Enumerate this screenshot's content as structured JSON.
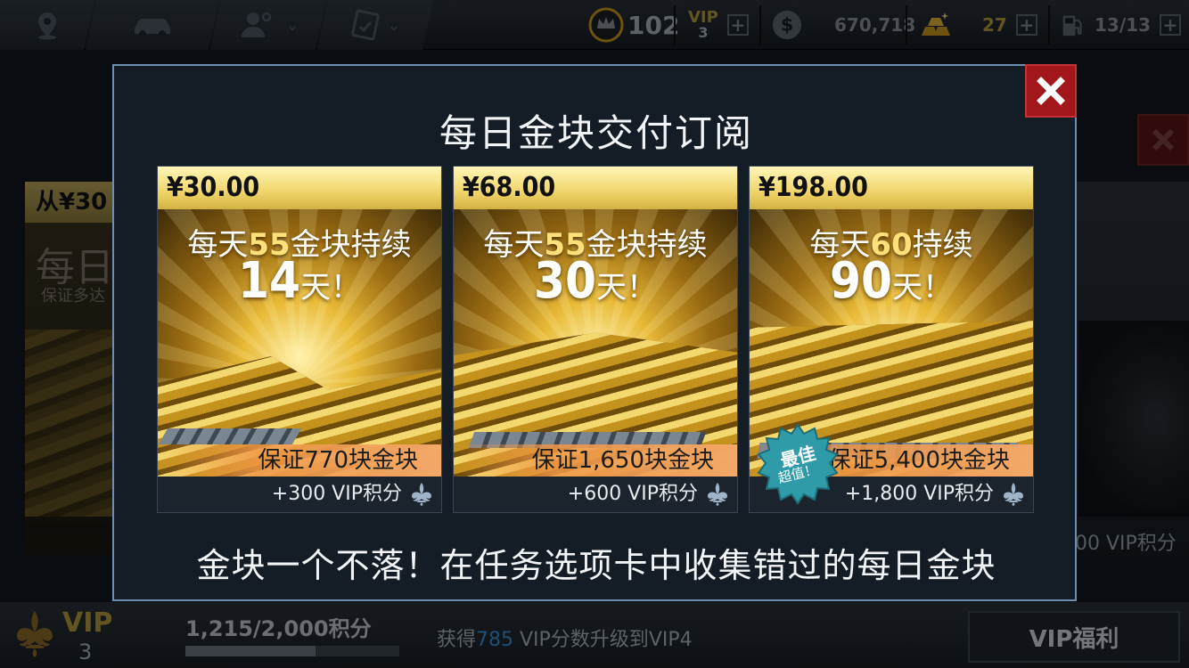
{
  "topbar": {
    "crown_value": "102",
    "vip_label": "VIP",
    "vip_level": "3",
    "cash_value": "670,718",
    "gold_value": "27",
    "fuel_value": "13/13"
  },
  "background": {
    "left_price": "从¥30",
    "left_title": "每日",
    "left_subtitle": "保证多达",
    "right_vip_points": "00 VIP积分"
  },
  "modal": {
    "title": "每日金块交付订阅",
    "footer": "金块一个不落！在任务选项卡中收集错过的每日金块",
    "cards": [
      {
        "price": "¥30.00",
        "line1_pre": "每天",
        "line1_num": "55",
        "line1_post": "金块持续",
        "days": "14",
        "days_suffix": "天！",
        "guarantee": "保证770块金块",
        "vip_points": "+300 VIP积分"
      },
      {
        "price": "¥68.00",
        "line1_pre": "每天",
        "line1_num": "55",
        "line1_post": "金块持续",
        "days": "30",
        "days_suffix": "天！",
        "guarantee": "保证1,650块金块",
        "vip_points": "+600 VIP积分"
      },
      {
        "price": "¥198.00",
        "line1_pre": "每天",
        "line1_num": "60",
        "line1_post": "持续",
        "days": "90",
        "days_suffix": "天！",
        "guarantee": "保证5,400块金块",
        "vip_points": "+1,800 VIP积分",
        "badge_line1": "最佳",
        "badge_line2": "超值！"
      }
    ]
  },
  "bottombar": {
    "vip_label": "VIP",
    "vip_level": "3",
    "progress_text": "1,215/2,000积分",
    "progress_fraction": 0.6075,
    "upgrade_pre": "获得",
    "upgrade_points": "785",
    "upgrade_post": " VIP分数升级到VIP4",
    "benefit_button": "VIP福利"
  },
  "colors": {
    "modal_border": "#6f8fb2",
    "close_red": "#a2171b",
    "price_gold": "#f0d46a",
    "vip_gold": "#b59b3c",
    "highlight_blue": "#3c8fd6"
  }
}
